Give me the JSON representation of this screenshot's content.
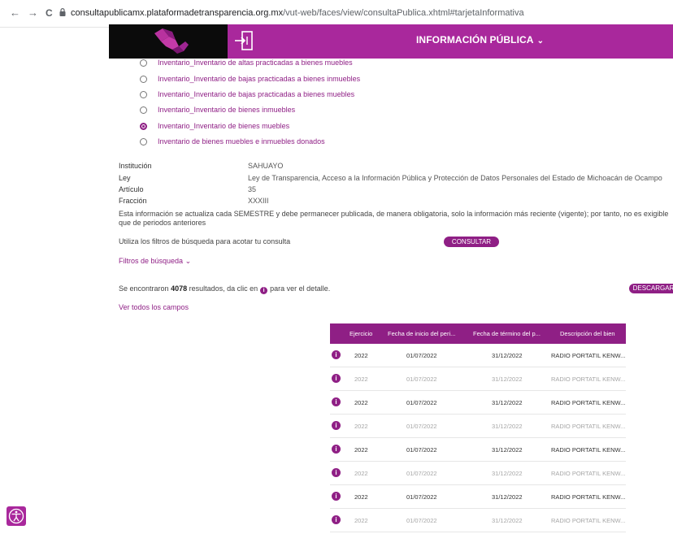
{
  "browser": {
    "back": "←",
    "forward": "→",
    "reload": "C",
    "url_host": "consultapublicamx.plataformadetransparencia.org.mx",
    "url_path": "/vut-web/faces/view/consultaPublica.xhtml#tarjetaInformativa"
  },
  "header": {
    "title": "INFORMACIÓN PÚBLICA",
    "chevron": "⌄",
    "brand_color": "#a9289c"
  },
  "formats": [
    {
      "label": "Inventario_Inventario de altas practicadas a bienes muebles",
      "selected": false
    },
    {
      "label": "Inventario_Inventario de bajas practicadas a bienes inmuebles",
      "selected": false
    },
    {
      "label": "Inventario_Inventario de bajas practicadas a bienes muebles",
      "selected": false
    },
    {
      "label": "Inventario_Inventario de bienes inmuebles",
      "selected": false
    },
    {
      "label": "Inventario_Inventario de bienes muebles",
      "selected": true
    },
    {
      "label": "Inventario de bienes muebles e inmuebles donados",
      "selected": false
    }
  ],
  "details": {
    "institucion_label": "Institución",
    "institucion": "SAHUAYO",
    "ley_label": "Ley",
    "ley": "Ley de Transparencia, Acceso a la Información Pública y Protección de Datos Personales del Estado de Michoacán de Ocampo",
    "articulo_label": "Artículo",
    "articulo": "35",
    "fraccion_label": "Fracción",
    "fraccion": "XXXIII",
    "note": "Esta información se actualiza cada SEMESTRE y debe permanecer publicada, de manera obligatoria, solo la información más reciente (vigente); por tanto, no es exigible que de periodos anteriores"
  },
  "search": {
    "hint": "Utiliza los filtros de búsqueda para acotar tu consulta",
    "consultar": "CONSULTAR",
    "filters": "Filtros de búsqueda",
    "filters_chevron": "⌄"
  },
  "results": {
    "prefix": "Se encontraron",
    "count": "4078",
    "middle": "resultados, da clic en",
    "suffix": "para ver el detalle.",
    "descargar": "DESCARGAR",
    "all_fields": "Ver todos los campos"
  },
  "table": {
    "headers": [
      "Ejercicio",
      "Fecha de inicio del peri...",
      "Fecha de término del p...",
      "Descripción del bien"
    ],
    "rows": [
      [
        "2022",
        "01/07/2022",
        "31/12/2022",
        "RADIO PORTATIL KENW..."
      ],
      [
        "2022",
        "01/07/2022",
        "31/12/2022",
        "RADIO PORTATIL KENW..."
      ],
      [
        "2022",
        "01/07/2022",
        "31/12/2022",
        "RADIO PORTATIL KENW..."
      ],
      [
        "2022",
        "01/07/2022",
        "31/12/2022",
        "RADIO PORTATIL KENW..."
      ],
      [
        "2022",
        "01/07/2022",
        "31/12/2022",
        "RADIO PORTATIL KENW..."
      ],
      [
        "2022",
        "01/07/2022",
        "31/12/2022",
        "RADIO PORTATIL KENW..."
      ],
      [
        "2022",
        "01/07/2022",
        "31/12/2022",
        "RADIO PORTATIL KENW..."
      ],
      [
        "2022",
        "01/07/2022",
        "31/12/2022",
        "RADIO PORTATIL KENW..."
      ]
    ]
  }
}
